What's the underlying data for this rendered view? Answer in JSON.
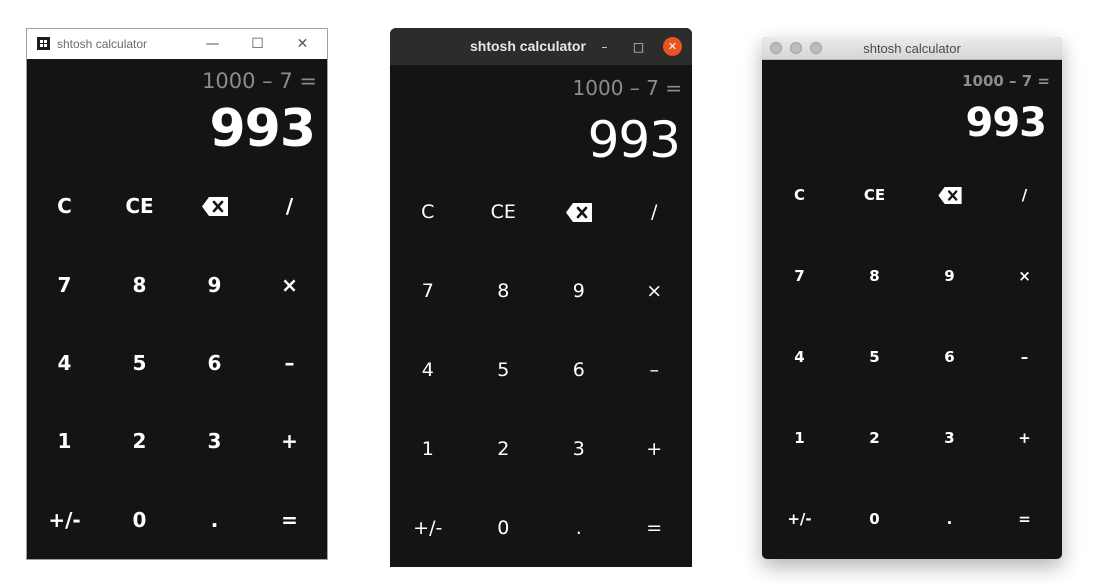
{
  "windows_window": {
    "title": "shtosh calculator",
    "controls": {
      "minimize": "—",
      "maximize": "☐",
      "close": "✕"
    },
    "expression": "1000 – 7 =",
    "result": "993",
    "keys": [
      "C",
      "CE",
      "⌫",
      "/",
      "7",
      "8",
      "9",
      "×",
      "4",
      "5",
      "6",
      "–",
      "1",
      "2",
      "3",
      "+",
      "+/-",
      "0",
      ".",
      "="
    ]
  },
  "ubuntu_window": {
    "title": "shtosh calculator",
    "controls": {
      "minimize": "–",
      "maximize": "□",
      "close": "✕"
    },
    "expression": "1000 – 7 =",
    "result": "993",
    "keys": [
      "C",
      "CE",
      "⌫",
      "/",
      "7",
      "8",
      "9",
      "×",
      "4",
      "5",
      "6",
      "–",
      "1",
      "2",
      "3",
      "+",
      "+/-",
      "0",
      ".",
      "="
    ]
  },
  "mac_window": {
    "title": "shtosh calculator",
    "expression": "1000 – 7 =",
    "result": "993",
    "keys": [
      "C",
      "CE",
      "⌫",
      "/",
      "7",
      "8",
      "9",
      "×",
      "4",
      "5",
      "6",
      "–",
      "1",
      "2",
      "3",
      "+",
      "+/-",
      "0",
      ".",
      "="
    ]
  },
  "colors": {
    "calc_background": "#141414",
    "expression_text": "#8c8c8c",
    "result_text": "#ffffff",
    "ubuntu_close": "#e95420"
  }
}
